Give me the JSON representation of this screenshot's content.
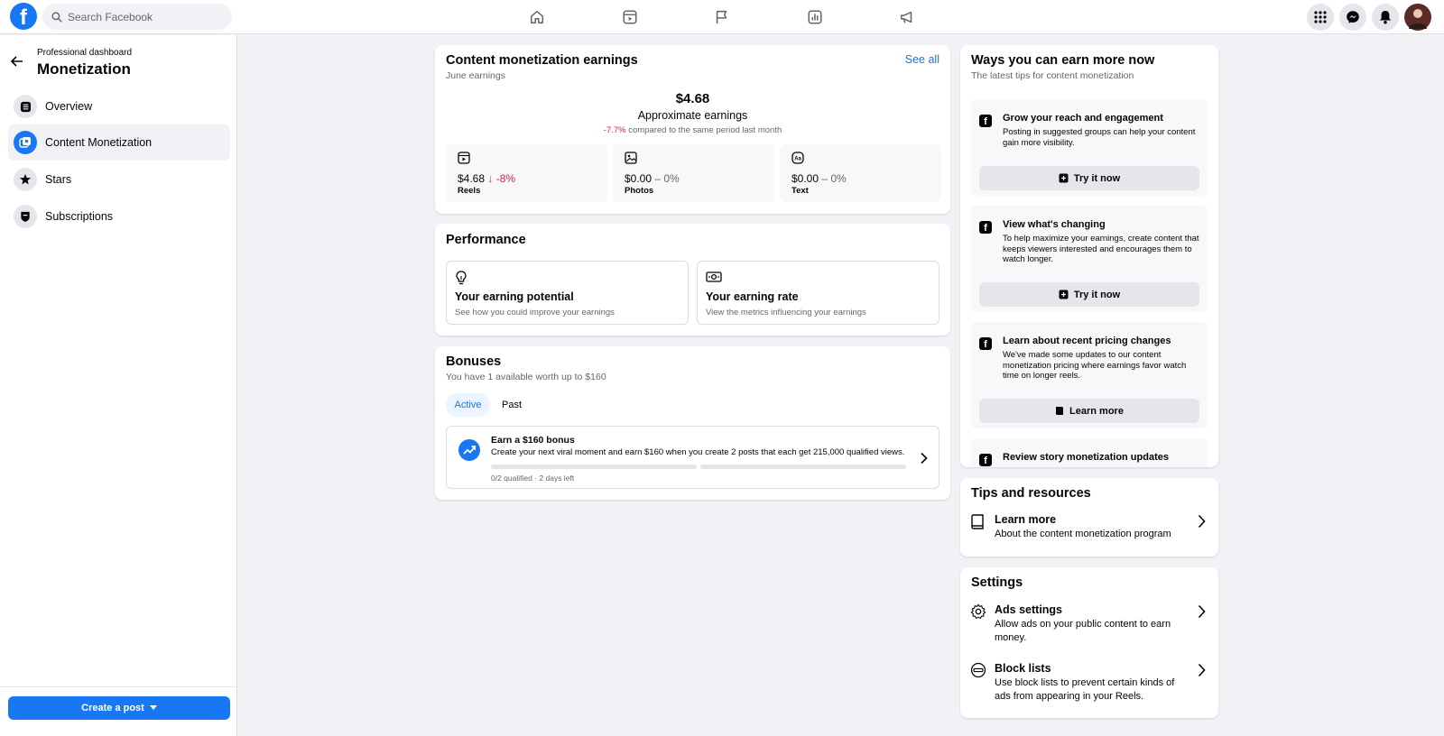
{
  "topnav": {
    "search_placeholder": "Search Facebook",
    "logo_letter": "f",
    "nav_icons": [
      "home-icon",
      "reels-icon",
      "pages-flag-icon",
      "dashboard-chart-icon",
      "ads-megaphone-icon"
    ],
    "right_icons": [
      "menu-grid-icon",
      "messenger-icon",
      "notifications-bell-icon",
      "profile-avatar"
    ]
  },
  "sidebar": {
    "subtitle": "Professional dashboard",
    "title": "Monetization",
    "items": [
      {
        "label": "Overview",
        "icon": "list-icon",
        "active": false
      },
      {
        "label": "Content Monetization",
        "icon": "content-icon",
        "active": true
      },
      {
        "label": "Stars",
        "icon": "stars-icon",
        "active": false
      },
      {
        "label": "Subscriptions",
        "icon": "shield-icon",
        "active": false
      }
    ],
    "create_button": "Create a post"
  },
  "earnings": {
    "title": "Content monetization earnings",
    "see_all": "See all",
    "period": "June earnings",
    "total": "$4.68",
    "total_label": "Approximate earnings",
    "change_pct": "-7.7%",
    "change_text": "compared to the same period last month",
    "tiles": [
      {
        "value": "$4.68",
        "change": "↓ -8%",
        "label": "Reels",
        "icon": "reels-icon"
      },
      {
        "value": "$0.00",
        "change": "– 0%",
        "label": "Photos",
        "icon": "photo-icon"
      },
      {
        "value": "$0.00",
        "change": "– 0%",
        "label": "Text",
        "icon": "text-icon"
      }
    ]
  },
  "performance": {
    "title": "Performance",
    "boxes": [
      {
        "title": "Your earning potential",
        "subtitle": "See how you could improve your earnings",
        "icon": "lightbulb-icon"
      },
      {
        "title": "Your earning rate",
        "subtitle": "View the metrics influencing your earnings",
        "icon": "money-icon"
      }
    ]
  },
  "bonuses": {
    "title": "Bonuses",
    "subtitle": "You have 1 available worth up to $160",
    "tabs": [
      "Active",
      "Past"
    ],
    "active_tab": "Active",
    "bonus": {
      "title": "Earn a $160 bonus",
      "description": "Create your next viral moment and earn $160 when you create 2 posts that each get 215,000 qualified views.",
      "status": "0/2 qualified · 2 days left",
      "progress": [
        0,
        0
      ]
    }
  },
  "ways": {
    "title": "Ways you can earn more now",
    "subtitle": "The latest tips for content monetization",
    "tips": [
      {
        "title": "Grow your reach and engagement",
        "description": "Posting in suggested groups can help your content gain more visibility.",
        "button": "Try it now",
        "button_icon": "plus-square-icon"
      },
      {
        "title": "View what's changing",
        "description": "To help maximize your earnings, create content that keeps viewers interested and encourages them to watch longer.",
        "button": "Try it now",
        "button_icon": "plus-square-icon"
      },
      {
        "title": "Learn about recent pricing changes",
        "description": "We've made some updates to our content monetization pricing where earnings favor watch time on longer reels.",
        "button": "Learn more",
        "button_icon": "book-icon"
      },
      {
        "title": "Review story monetization updates",
        "description": "",
        "button": "",
        "button_icon": ""
      }
    ]
  },
  "tips_resources": {
    "title": "Tips and resources",
    "item": {
      "title": "Learn more",
      "subtitle": "About the content monetization program",
      "icon": "book-icon"
    }
  },
  "settings": {
    "title": "Settings",
    "items": [
      {
        "title": "Ads settings",
        "subtitle": "Allow ads on your public content to earn money.",
        "icon": "gear-icon"
      },
      {
        "title": "Block lists",
        "subtitle": "Use block lists to prevent certain kinds of ads from appearing in your Reels.",
        "icon": "block-icon"
      }
    ]
  },
  "colors": {
    "brand": "#1877f2",
    "negative": "#e41e3f",
    "background": "#f0f2f5"
  }
}
